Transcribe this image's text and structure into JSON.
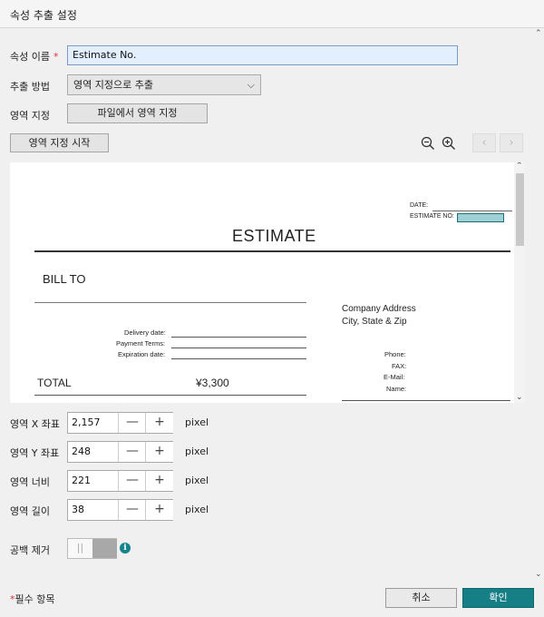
{
  "dialog": {
    "title": "속성 추출 설정"
  },
  "form": {
    "name_label": "속성 이름",
    "required_marker": "*",
    "name_value": "Estimate No.",
    "method_label": "추출 방법",
    "method_value": "영역 지정으로 추출",
    "region_label": "영역 지정",
    "region_file_button": "파일에서 영역 지정",
    "start_button": "영역 지정 시작"
  },
  "toolbar": {
    "zoom_out_icon": "zoom-out-icon",
    "zoom_in_icon": "zoom-in-icon",
    "prev_icon": "chevron-left-icon",
    "next_icon": "chevron-right-icon"
  },
  "preview": {
    "date_label": "DATE:",
    "estimate_no_label": "ESTIMATE NO:",
    "heading": "ESTIMATE",
    "bill_to": "BILL TO",
    "company_address": "Company Address",
    "city_state_zip": "City, State & Zip",
    "delivery_date": "Delivery date:",
    "payment_terms": "Payment Terms:",
    "expiration_date": "Expiration date:",
    "phone": "Phone:",
    "fax": "FAX:",
    "email": "E-Mail:",
    "name": "Name:",
    "total_label": "TOTAL",
    "total_value": "¥3,300"
  },
  "coords": {
    "x_label": "영역 X 좌표",
    "x_value": "2,157",
    "y_label": "영역 Y 좌표",
    "y_value": "248",
    "width_label": "영역 너비",
    "width_value": "221",
    "height_label": "영역 길이",
    "height_value": "38",
    "unit": "pixel"
  },
  "whitespace": {
    "label": "공백 제거",
    "enabled": false
  },
  "footer": {
    "required_note_star": "*",
    "required_note": "필수 항목",
    "cancel": "취소",
    "ok": "확인"
  },
  "colors": {
    "accent": "#167f86",
    "required": "#e0303a",
    "input_bg": "#e3efff",
    "highlight": "#9ed0d6"
  }
}
